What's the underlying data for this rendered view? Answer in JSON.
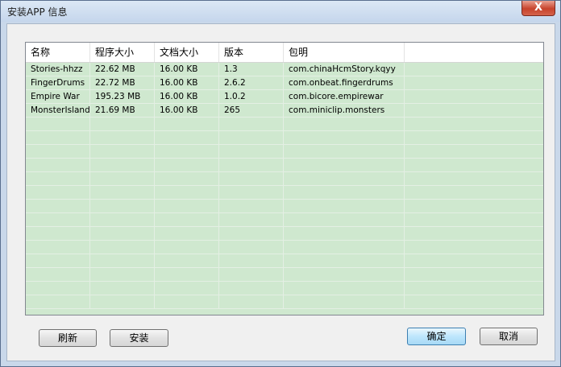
{
  "window": {
    "title": "安装APP 信息",
    "close_label": "X"
  },
  "table": {
    "columns": [
      "名称",
      "程序大小",
      "文档大小",
      "版本",
      "包明",
      ""
    ],
    "rows": [
      [
        "Stories-hhzz",
        "22.62 MB",
        "16.00 KB",
        "1.3",
        "com.chinaHcmStory.kqyy"
      ],
      [
        "FingerDrums",
        "22.72 MB",
        "16.00 KB",
        "2.6.2",
        "com.onbeat.fingerdrums"
      ],
      [
        "Empire War",
        "195.23 MB",
        "16.00 KB",
        "1.0.2",
        "com.bicore.empirewar"
      ],
      [
        "MonsterIsland",
        "21.69 MB",
        "16.00 KB",
        "265",
        "com.miniclip.monsters"
      ]
    ],
    "empty_row_count": 14
  },
  "buttons": {
    "refresh": "刷新",
    "install": "安装",
    "ok": "确定",
    "cancel": "取消"
  },
  "colors": {
    "list_bg": "#cfe8cf",
    "title_bg": "#c9d8ea",
    "close_bg": "#c7432c"
  }
}
